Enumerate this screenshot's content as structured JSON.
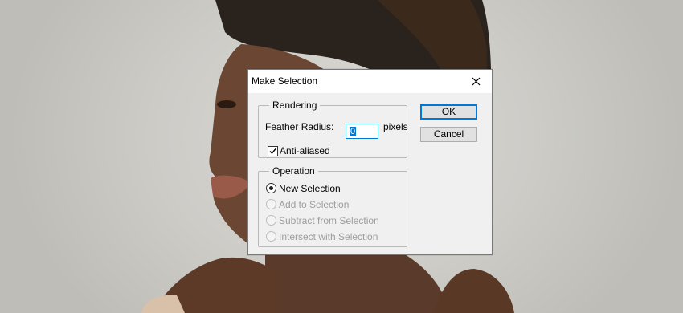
{
  "dialog": {
    "title": "Make Selection",
    "rendering": {
      "legend": "Rendering",
      "feather_label": "Feather Radius:",
      "feather_value": "0",
      "feather_unit": "pixels",
      "anti_aliased_label": "Anti-aliased",
      "anti_aliased_checked": true
    },
    "operation": {
      "legend": "Operation",
      "options": [
        {
          "label": "New Selection",
          "selected": true,
          "enabled": true
        },
        {
          "label": "Add to Selection",
          "selected": false,
          "enabled": false
        },
        {
          "label": "Subtract from Selection",
          "selected": false,
          "enabled": false
        },
        {
          "label": "Intersect with Selection",
          "selected": false,
          "enabled": false
        }
      ]
    },
    "buttons": {
      "ok": "OK",
      "cancel": "Cancel"
    }
  },
  "icons": {
    "close": "close-icon",
    "check": "checkmark-icon"
  },
  "colors": {
    "accent": "#0078d7",
    "dialog_bg": "#f0f0f0",
    "disabled_text": "#9d9d9d"
  }
}
